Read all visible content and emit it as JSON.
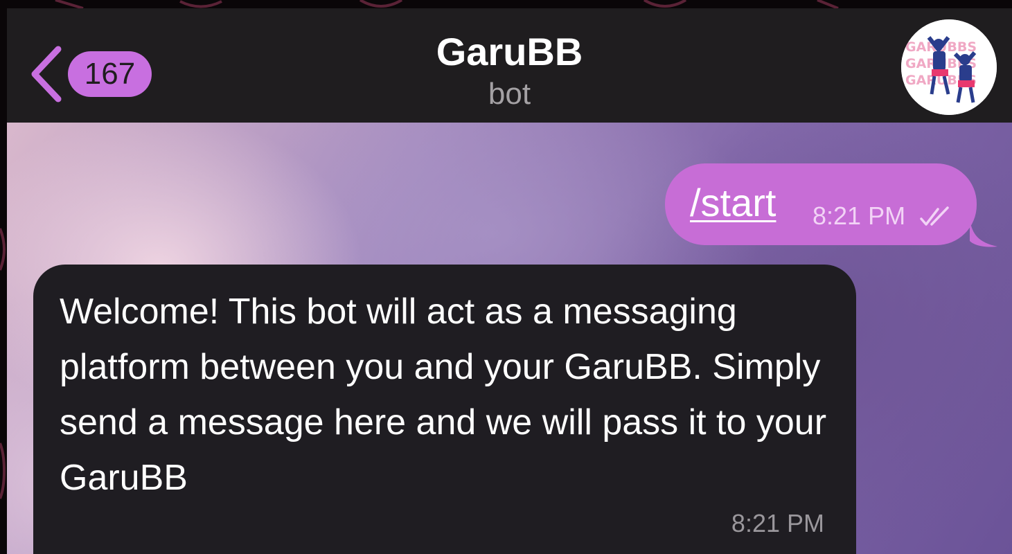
{
  "header": {
    "back_badge_count": "167",
    "chat_title": "GaruBB",
    "chat_subtitle": "bot",
    "avatar": {
      "lines": [
        "GARUBBS",
        "GARUBBS",
        "GARUBBS"
      ]
    }
  },
  "messages": [
    {
      "direction": "outgoing",
      "text": "/start",
      "time": "8:21 PM",
      "status_icon": "double-check-icon"
    },
    {
      "direction": "incoming",
      "text": "Welcome! This bot will act as a messaging platform between you and your GaruBB. Simply send a message here and we will pass it to your GaruBB",
      "time": "8:21 PM"
    }
  ],
  "colors": {
    "accent": "#c86fe0",
    "outgoing_bubble": "#c76dd6",
    "incoming_bubble": "#1f1d22",
    "header_bg": "#1f1d1f"
  }
}
